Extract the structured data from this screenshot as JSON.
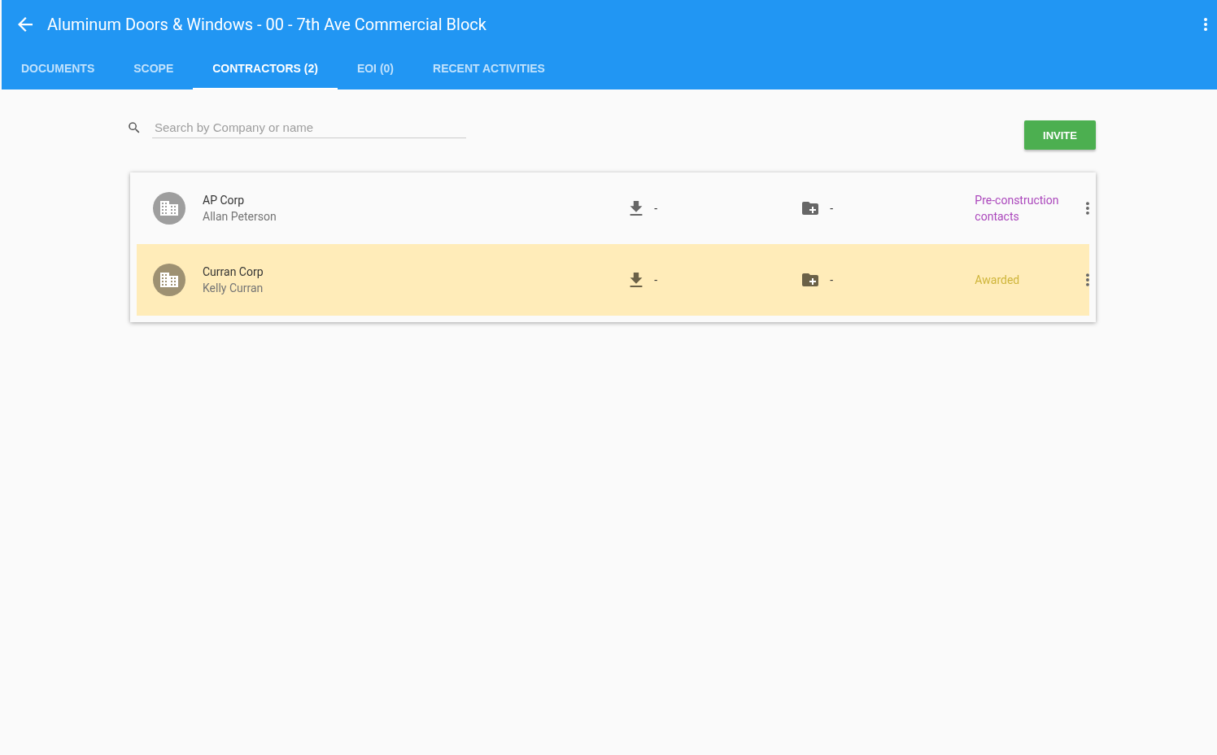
{
  "header": {
    "title": "Aluminum Doors & Windows - 00 - 7th Ave Commercial Block"
  },
  "tabs": [
    {
      "label": "DOCUMENTS",
      "selected": false
    },
    {
      "label": "SCOPE",
      "selected": false
    },
    {
      "label": "CONTRACTORS (2)",
      "selected": true
    },
    {
      "label": "EOI (0)",
      "selected": false
    },
    {
      "label": "RECENT ACTIVITIES",
      "selected": false
    }
  ],
  "search": {
    "placeholder": "Search by Company or name"
  },
  "invite_button": "INVITE",
  "contractors": [
    {
      "company": "AP Corp",
      "contact": "Allan Peterson",
      "downloads": "-",
      "folders": "-",
      "status": "Pre-construction contacts",
      "color": "#ab47bc",
      "highlighted": false
    },
    {
      "company": "Curran Corp",
      "contact": "Kelly Curran",
      "downloads": "-",
      "folders": "-",
      "status": "Awarded",
      "color": "#cfb53b",
      "highlighted": true
    }
  ]
}
